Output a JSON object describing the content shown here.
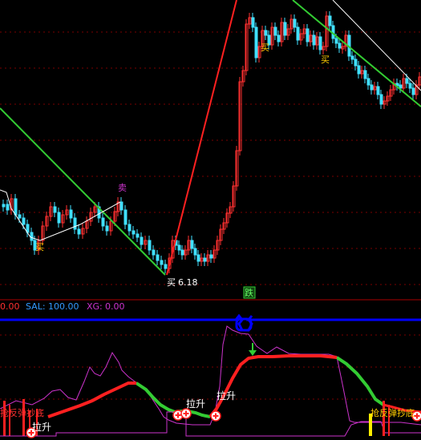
{
  "colors": {
    "background": "#000000",
    "grid": "#8b0000",
    "candle_up": "#ff3030",
    "candle_down": "#40e0ff",
    "trend_green": "#33cc33",
    "trend_red": "#ff2020",
    "trend_white": "#ffffff",
    "baseline_blue": "#0000ff",
    "magenta": "#cc33cc",
    "label_yellow": "#ffcc00",
    "label_white": "#ffffff",
    "label_red": "#ff3030",
    "label_green": "#33cc33"
  },
  "price_panel": {
    "annotations": {
      "buy_1": "买",
      "sell_1": "卖",
      "buy_2": "买",
      "buy_3": "买",
      "buy_4": "买",
      "low_price": "6.18",
      "fall_badge": "跌"
    }
  },
  "indicator_panel": {
    "header": {
      "first_value": "0.00",
      "sal_label": "SAL:",
      "sal_value": "100.00",
      "xg_label": "XG:",
      "xg_value": "0.00"
    },
    "annotations": {
      "lift_1": "拉升",
      "lift_2": "拉升",
      "lift_3": "拉升",
      "bottom_left": "抢反弹抄底",
      "bottom_right": "抢反弹抄底"
    }
  }
}
